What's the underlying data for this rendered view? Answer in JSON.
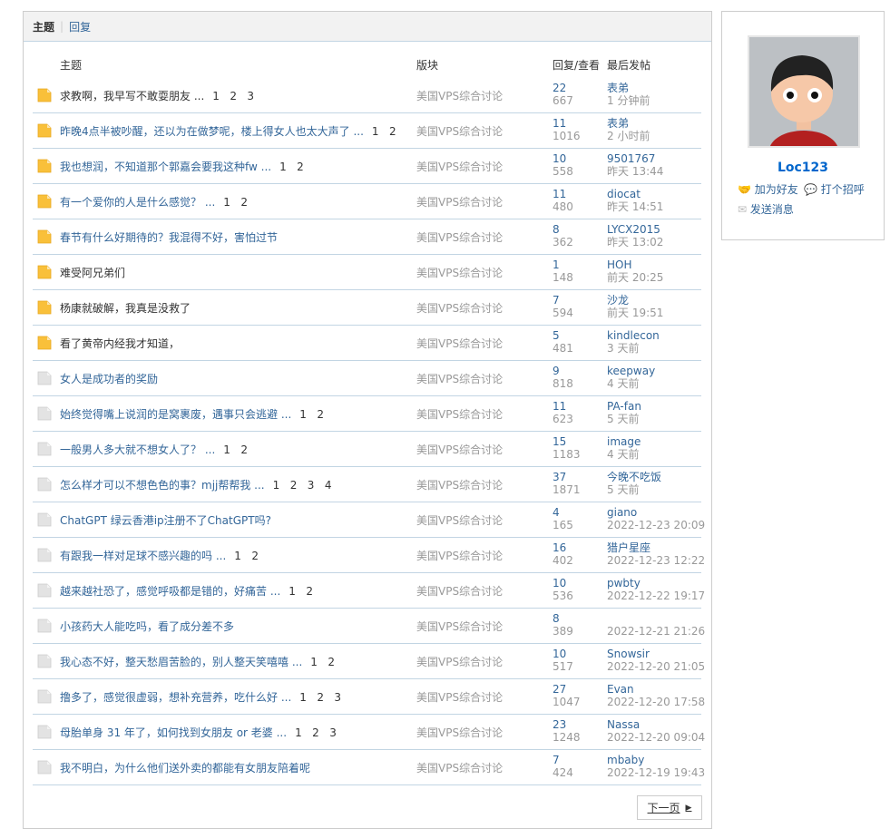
{
  "tabs": {
    "topic": "主题",
    "reply": "回复"
  },
  "header": {
    "topic": "主题",
    "forum": "版块",
    "replies_views": "回复/查看",
    "last_post": "最后发帖"
  },
  "rows": [
    {
      "title": "求教啊，我早写不敢耍朋友 ...",
      "pages": "1   2   3",
      "hot": true,
      "visited": true,
      "forum": "美国VPS综合讨论",
      "replies": "22",
      "views": "667",
      "author": "表弟",
      "time": "1 分钟前"
    },
    {
      "title": "昨晚4点半被吵醒，还以为在做梦呢，楼上得女人也太大声了 ...",
      "pages": "1   2",
      "hot": true,
      "visited": false,
      "forum": "美国VPS综合讨论",
      "replies": "11",
      "views": "1016",
      "author": "表弟",
      "time": "2 小时前"
    },
    {
      "title": "我也想润，不知道那个郭嘉会要我这种fw ...",
      "pages": "1   2",
      "hot": true,
      "visited": false,
      "forum": "美国VPS综合讨论",
      "replies": "10",
      "views": "558",
      "author": "9501767",
      "time": "昨天 13:44"
    },
    {
      "title": "有一个爱你的人是什么感觉？ ...",
      "pages": "1   2",
      "hot": true,
      "visited": false,
      "forum": "美国VPS综合讨论",
      "replies": "11",
      "views": "480",
      "author": "diocat",
      "time": "昨天 14:51"
    },
    {
      "title": "春节有什么好期待的？我混得不好，害怕过节",
      "pages": "",
      "hot": true,
      "visited": false,
      "forum": "美国VPS综合讨论",
      "replies": "8",
      "views": "362",
      "author": "LYCX2015",
      "time": "昨天 13:02"
    },
    {
      "title": "难受阿兄弟们",
      "pages": "",
      "hot": true,
      "visited": true,
      "forum": "美国VPS综合讨论",
      "replies": "1",
      "views": "148",
      "author": "HOH",
      "time": "前天 20:25"
    },
    {
      "title": "杨康就破解，我真是没救了",
      "pages": "",
      "hot": true,
      "visited": true,
      "forum": "美国VPS综合讨论",
      "replies": "7",
      "views": "594",
      "author": "沙龙",
      "time": "前天 19:51"
    },
    {
      "title": "看了黄帝内经我才知道，",
      "pages": "",
      "hot": true,
      "visited": true,
      "forum": "美国VPS综合讨论",
      "replies": "5",
      "views": "481",
      "author": "kindlecon",
      "time": "3 天前"
    },
    {
      "title": "女人是成功者的奖励",
      "pages": "",
      "hot": false,
      "visited": false,
      "forum": "美国VPS综合讨论",
      "replies": "9",
      "views": "818",
      "author": "keepway",
      "time": "4 天前"
    },
    {
      "title": "始终觉得嘴上说润的是窝裹废，遇事只会逃避 ...",
      "pages": "1   2",
      "hot": false,
      "visited": false,
      "forum": "美国VPS综合讨论",
      "replies": "11",
      "views": "623",
      "author": "PA-fan",
      "time": "5 天前"
    },
    {
      "title": "一般男人多大就不想女人了？ ...",
      "pages": "1   2",
      "hot": false,
      "visited": false,
      "forum": "美国VPS综合讨论",
      "replies": "15",
      "views": "1183",
      "author": "image",
      "time": "4 天前"
    },
    {
      "title": "怎么样才可以不想色色的事？mjj帮帮我 ...",
      "pages": "1   2   3   4",
      "hot": false,
      "visited": false,
      "forum": "美国VPS综合讨论",
      "replies": "37",
      "views": "1871",
      "author": "今晚不吃饭",
      "time": "5 天前"
    },
    {
      "title": "ChatGPT 绿云香港ip注册不了ChatGPT吗?",
      "pages": "",
      "hot": false,
      "visited": false,
      "forum": "美国VPS综合讨论",
      "replies": "4",
      "views": "165",
      "author": "giano",
      "time": "2022-12-23 20:09"
    },
    {
      "title": "有跟我一样对足球不感兴趣的吗 ...",
      "pages": "1   2",
      "hot": false,
      "visited": false,
      "forum": "美国VPS综合讨论",
      "replies": "16",
      "views": "402",
      "author": "猎户星座",
      "time": "2022-12-23 12:22"
    },
    {
      "title": "越来越社恐了，感觉呼吸都是错的，好痛苦 ...",
      "pages": "1   2",
      "hot": false,
      "visited": false,
      "forum": "美国VPS综合讨论",
      "replies": "10",
      "views": "536",
      "author": "pwbty",
      "time": "2022-12-22 19:17"
    },
    {
      "title": "小孩药大人能吃吗，看了成分差不多",
      "pages": "",
      "hot": false,
      "visited": false,
      "forum": "美国VPS综合讨论",
      "replies": "8",
      "views": "389",
      "author": "",
      "time": "2022-12-21 21:26"
    },
    {
      "title": "我心态不好，整天愁眉苦脸的，别人整天笑嘻嘻 ...",
      "pages": "1   2",
      "hot": false,
      "visited": false,
      "forum": "美国VPS综合讨论",
      "replies": "10",
      "views": "517",
      "author": "Snowsir",
      "time": "2022-12-20 21:05"
    },
    {
      "title": "撸多了，感觉很虚弱，想补充营养，吃什么好 ...",
      "pages": "1   2   3",
      "hot": false,
      "visited": false,
      "forum": "美国VPS综合讨论",
      "replies": "27",
      "views": "1047",
      "author": "Evan",
      "time": "2022-12-20 17:58"
    },
    {
      "title": "母胎单身 31 年了，如何找到女朋友 or 老婆 ...",
      "pages": "1   2   3",
      "hot": false,
      "visited": false,
      "forum": "美国VPS综合讨论",
      "replies": "23",
      "views": "1248",
      "author": "Nassa",
      "time": "2022-12-20 09:04"
    },
    {
      "title": "我不明白，为什么他们送外卖的都能有女朋友陪着呢",
      "pages": "",
      "hot": false,
      "visited": false,
      "forum": "美国VPS综合讨论",
      "replies": "7",
      "views": "424",
      "author": "mbaby",
      "time": "2022-12-19 19:43"
    }
  ],
  "pagination": {
    "next": "下一页"
  },
  "profile": {
    "username": "Loc123",
    "add_friend": "加为好友",
    "greet": "打个招呼",
    "send_message": "发送消息"
  },
  "colors": {
    "link": "#336699",
    "hot_folder": "#f9c03a",
    "cold_folder": "#e3e3e3",
    "border": "#c2d5e3"
  }
}
